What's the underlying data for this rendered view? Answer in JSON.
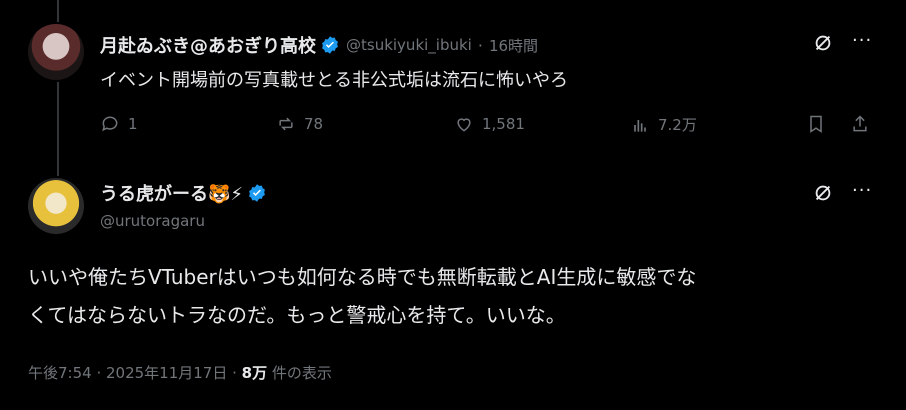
{
  "reply_to": {
    "display_name": "月赴ゐぶき@あおぎり高校",
    "handle": "@tsukiyuki_ibuki",
    "time": "16時間",
    "text": "イベント開場前の写真載せとる非公式垢は流石に怖いやろ",
    "stats": {
      "replies": "1",
      "reposts": "78",
      "likes": "1,581",
      "views": "7.2万"
    }
  },
  "main_post": {
    "display_name": "うる虎がーる🐯⚡",
    "handle": "@urutoragaru",
    "text_line1": "いいや俺たちVTuberはいつも如何なる時でも無断転載とAI生成に敏感でな",
    "text_line2": "くてはならないトラなのだ。もっと警戒心を持て。いいな。",
    "timestamp": "午後7:54 · 2025年11月17日 · ",
    "views_count": "8万",
    "views_label": " 件の表示"
  },
  "colors": {
    "background": "#000000",
    "text": "#e7e9ea",
    "muted": "#71767b",
    "verified": "#1d9bf0"
  }
}
